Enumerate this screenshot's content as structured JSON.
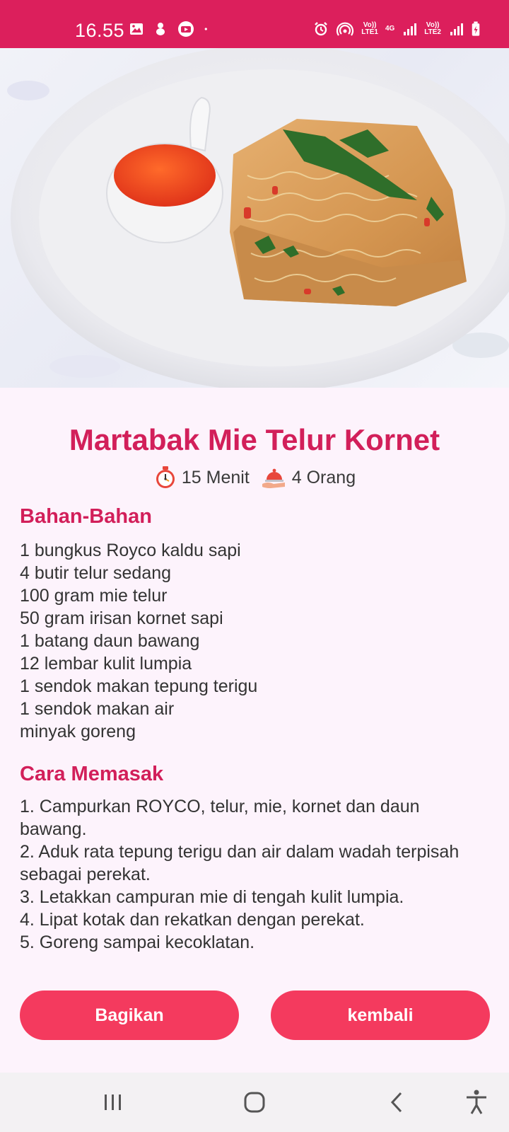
{
  "status_bar": {
    "time": "16.55",
    "left_icons": [
      "gallery-icon",
      "app-notification-icon",
      "youtube-icon",
      "dot-icon"
    ],
    "right_icons": [
      "alarm-icon",
      "hotspot-icon",
      "volte-lte1-icon",
      "4g-icon",
      "signal-1-icon",
      "volte-lte2-icon",
      "signal-2-icon",
      "battery-charging-icon"
    ],
    "sim1_label": "Vo))\nLTE1",
    "network_label": "4G",
    "sim2_label": "Vo))\nLTE2"
  },
  "recipe": {
    "title": "Martabak Mie Telur Kornet",
    "time": "15 Menit",
    "servings": "4 Orang",
    "ingredients_heading": "Bahan-Bahan",
    "ingredients": [
      "1 bungkus Royco kaldu sapi",
      "4 butir telur sedang",
      "100 gram mie telur",
      "50 gram irisan kornet sapi",
      "1 batang daun bawang",
      "12 lembar kulit lumpia",
      "1 sendok makan tepung terigu",
      "1 sendok makan air",
      "minyak goreng"
    ],
    "steps_heading": "Cara Memasak",
    "steps": [
      "1. Campurkan ROYCO, telur, mie, kornet dan daun bawang.",
      "2. Aduk rata tepung terigu dan air dalam wadah terpisah sebagai perekat.",
      "3. Letakkan campuran mie di tengah kulit lumpia.",
      "4. Lipat kotak dan rekatkan dengan perekat.",
      "5. Goreng sampai kecoklatan."
    ]
  },
  "buttons": {
    "share_label": "Bagikan",
    "back_label": "kembali"
  },
  "nav": {
    "icons": [
      "recents-icon",
      "home-icon",
      "back-icon",
      "accessibility-icon"
    ]
  },
  "colors": {
    "status_bar": "#dc1f5c",
    "accent": "#d21f5a",
    "button": "#f43a5e",
    "background": "#fdf3fc"
  }
}
